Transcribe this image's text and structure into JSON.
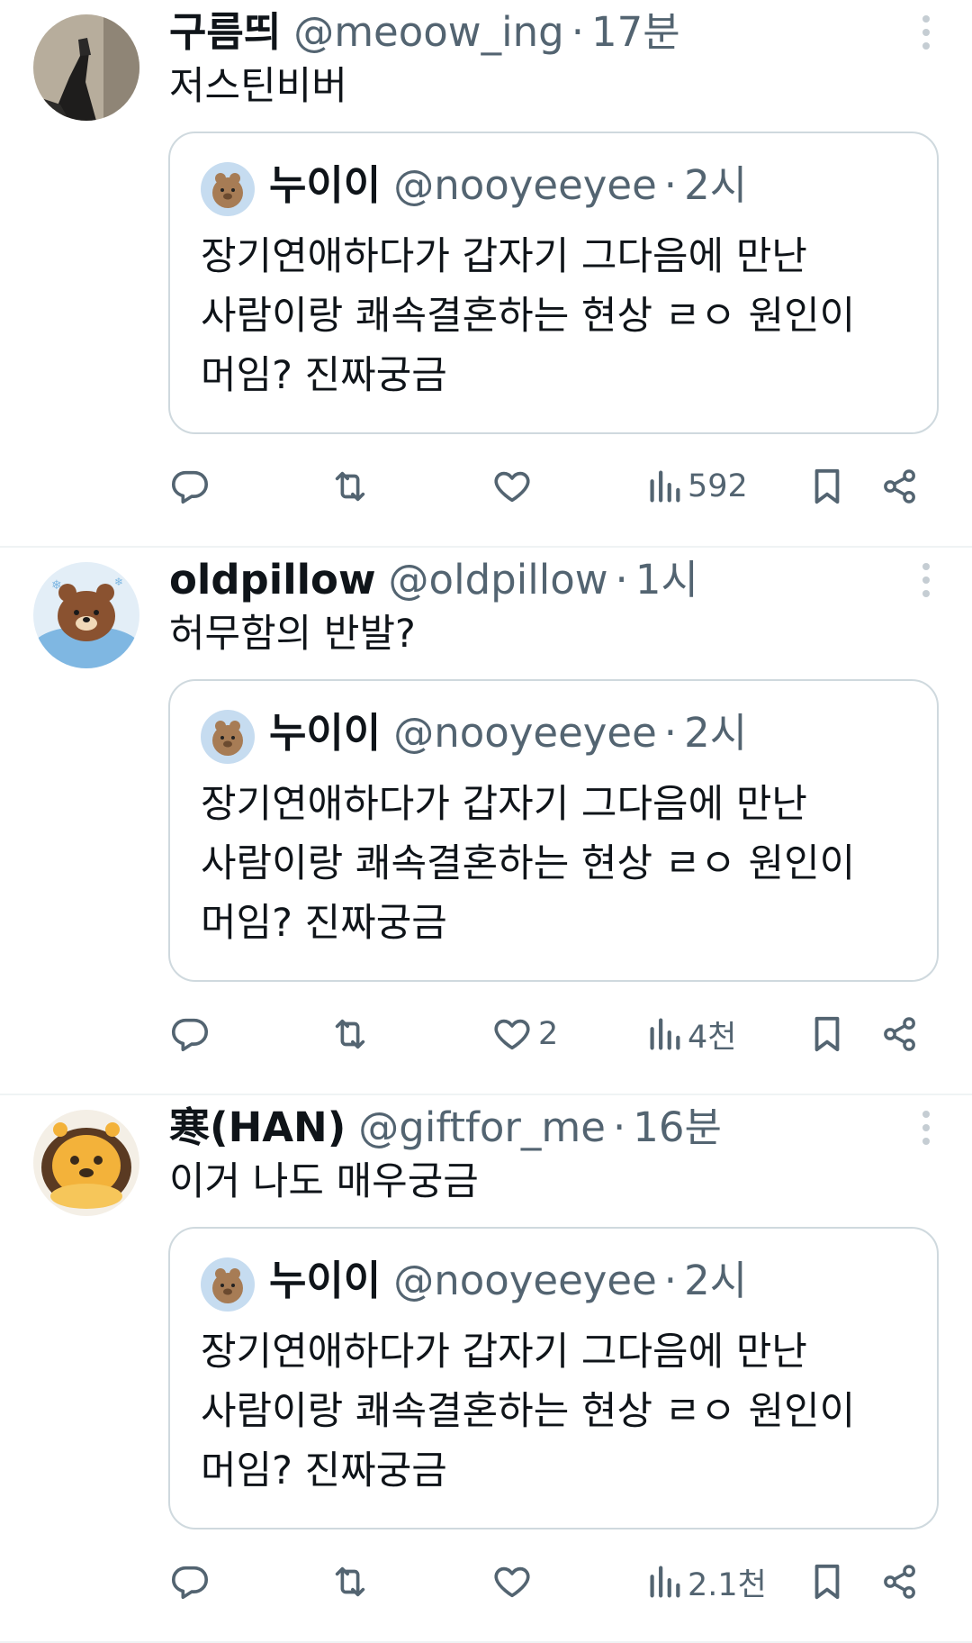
{
  "tweets": [
    {
      "name": "구름띄",
      "handle": "@meoow_ing",
      "time": "17분",
      "text": "저스틴비버",
      "avatar_icon": "photo-avatar",
      "quote": {
        "name": "누이이",
        "handle": "@nooyeeyee",
        "time": "2시",
        "lines": [
          "장기연애하다가 갑자기 그다음에 만난",
          "사람이랑 쾌속결혼하는 현상 ㄹㅇ 원인이",
          "머임? 진짜궁금"
        ]
      },
      "actions": {
        "reply": "",
        "retweet": "",
        "like": "",
        "views": "592"
      }
    },
    {
      "name": "oldpillow",
      "handle": "@oldpillow",
      "time": "1시",
      "text": "허무함의 반발?",
      "avatar_icon": "bear-avatar",
      "quote": {
        "name": "누이이",
        "handle": "@nooyeeyee",
        "time": "2시",
        "lines": [
          "장기연애하다가 갑자기 그다음에 만난",
          "사람이랑 쾌속결혼하는 현상 ㄹㅇ 원인이",
          "머임? 진짜궁금"
        ]
      },
      "actions": {
        "reply": "",
        "retweet": "",
        "like": "2",
        "views": "4천"
      }
    },
    {
      "name": "寒(HAN)",
      "handle": "@giftfor_me",
      "time": "16분",
      "text": "이거 나도 매우궁금",
      "avatar_icon": "lion-cake-avatar",
      "quote": {
        "name": "누이이",
        "handle": "@nooyeeyee",
        "time": "2시",
        "lines": [
          "장기연애하다가 갑자기 그다음에 만난",
          "사람이랑 쾌속결혼하는 현상 ㄹㅇ 원인이",
          "머임? 진짜궁금"
        ]
      },
      "actions": {
        "reply": "",
        "retweet": "",
        "like": "",
        "views": "2.1천"
      }
    }
  ],
  "separator": "·",
  "colors": {
    "text": "#0f1419",
    "secondary": "#536471",
    "border": "#cfd9de",
    "divider": "#eff3f4"
  }
}
